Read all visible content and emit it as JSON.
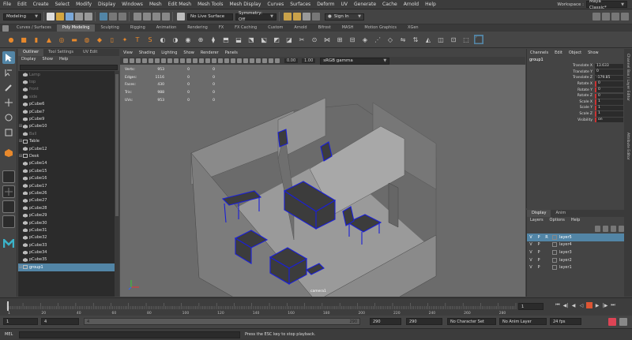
{
  "menubar": {
    "items": [
      "File",
      "Edit",
      "Create",
      "Select",
      "Modify",
      "Display",
      "Windows",
      "Mesh",
      "Edit Mesh",
      "Mesh Tools",
      "Mesh Display",
      "Curves",
      "Surfaces",
      "Deform",
      "UV",
      "Generate",
      "Cache",
      "Arnold",
      "Help"
    ],
    "workspace_label": "Workspace :",
    "workspace_value": "Maya Classic*"
  },
  "statusline": {
    "mode": "Modeling",
    "live_surface": "No Live Surface",
    "symmetry": "Symmetry: Off",
    "sign_in": "Sign In"
  },
  "shelf": {
    "tabs": [
      "Curves / Surfaces",
      "Poly Modeling",
      "Sculpting",
      "Rigging",
      "Animation",
      "Rendering",
      "FX",
      "FX Caching",
      "Custom",
      "Arnold",
      "Bifrost",
      "MASH",
      "Motion Graphics",
      "XGen"
    ],
    "active_tab": "Poly Modeling"
  },
  "outliner": {
    "tabs": [
      "Outliner",
      "Tool Settings",
      "UV Edit"
    ],
    "menu": [
      "Display",
      "Show",
      "Help"
    ],
    "items": [
      {
        "label": "Lamp",
        "dim": true,
        "group": false,
        "expand": false
      },
      {
        "label": "top",
        "dim": true,
        "group": false,
        "expand": false
      },
      {
        "label": "front",
        "dim": true,
        "group": false,
        "expand": false
      },
      {
        "label": "side",
        "dim": true,
        "group": false,
        "expand": false
      },
      {
        "label": "pCube6",
        "dim": false,
        "group": false,
        "expand": false
      },
      {
        "label": "pCube7",
        "dim": false,
        "group": false,
        "expand": false
      },
      {
        "label": "pCube9",
        "dim": false,
        "group": false,
        "expand": false
      },
      {
        "label": "pCube10",
        "dim": false,
        "group": false,
        "expand": true
      },
      {
        "label": "Ball",
        "dim": true,
        "group": false,
        "expand": false
      },
      {
        "label": "Table",
        "dim": false,
        "group": true,
        "expand": true
      },
      {
        "label": "pCube12",
        "dim": false,
        "group": false,
        "expand": false
      },
      {
        "label": "Desk",
        "dim": false,
        "group": true,
        "expand": true
      },
      {
        "label": "pCube14",
        "dim": false,
        "group": false,
        "expand": false
      },
      {
        "label": "pCube15",
        "dim": false,
        "group": false,
        "expand": false
      },
      {
        "label": "pCube16",
        "dim": false,
        "group": false,
        "expand": false
      },
      {
        "label": "pCube17",
        "dim": false,
        "group": false,
        "expand": false
      },
      {
        "label": "pCube26",
        "dim": false,
        "group": false,
        "expand": false
      },
      {
        "label": "pCube27",
        "dim": false,
        "group": false,
        "expand": false
      },
      {
        "label": "pCube28",
        "dim": false,
        "group": false,
        "expand": false
      },
      {
        "label": "pCube29",
        "dim": false,
        "group": false,
        "expand": false
      },
      {
        "label": "pCube30",
        "dim": false,
        "group": false,
        "expand": false
      },
      {
        "label": "pCube31",
        "dim": false,
        "group": false,
        "expand": false
      },
      {
        "label": "pCube32",
        "dim": false,
        "group": false,
        "expand": false
      },
      {
        "label": "pCube33",
        "dim": false,
        "group": false,
        "expand": false
      },
      {
        "label": "pCube34",
        "dim": false,
        "group": false,
        "expand": false
      },
      {
        "label": "pCube35",
        "dim": false,
        "group": false,
        "expand": false
      },
      {
        "label": "group1",
        "dim": false,
        "group": true,
        "expand": true,
        "selected": true
      }
    ]
  },
  "viewport": {
    "menu": [
      "View",
      "Shading",
      "Lighting",
      "Show",
      "Renderer",
      "Panels"
    ],
    "colorspace": "sRGB gamma",
    "exposure": "0.00",
    "gamma": "1.00",
    "camera_label": "camera1",
    "hud": [
      {
        "label": "Verts:",
        "v1": "953",
        "v2": "0",
        "v3": "0"
      },
      {
        "label": "Edges:",
        "v1": "1116",
        "v2": "0",
        "v3": "0"
      },
      {
        "label": "Faces:",
        "v1": "430",
        "v2": "0",
        "v3": "0"
      },
      {
        "label": "Tris:",
        "v1": "988",
        "v2": "0",
        "v3": "0"
      },
      {
        "label": "UVs:",
        "v1": "953",
        "v2": "0",
        "v3": "0"
      }
    ]
  },
  "channelbox": {
    "menu": [
      "Channels",
      "Edit",
      "Object",
      "Show"
    ],
    "object": "group1",
    "attributes": [
      {
        "name": "Translate X",
        "value": "13.633",
        "keyed": false
      },
      {
        "name": "Translate Y",
        "value": "0",
        "keyed": false
      },
      {
        "name": "Translate Z",
        "value": "-179.85",
        "keyed": false
      },
      {
        "name": "Rotate X",
        "value": "0",
        "keyed": true
      },
      {
        "name": "Rotate Y",
        "value": "0",
        "keyed": true
      },
      {
        "name": "Rotate Z",
        "value": "0",
        "keyed": true
      },
      {
        "name": "Scale X",
        "value": "1",
        "keyed": true
      },
      {
        "name": "Scale Y",
        "value": "1",
        "keyed": true
      },
      {
        "name": "Scale Z",
        "value": "1",
        "keyed": true
      },
      {
        "name": "Visibility",
        "value": "on",
        "keyed": true
      }
    ]
  },
  "layers": {
    "tabs": [
      "Display",
      "Anim"
    ],
    "menu": [
      "Layers",
      "Options",
      "Help"
    ],
    "rows": [
      {
        "v": "V",
        "p": "P",
        "r": "R",
        "name": "layer5",
        "selected": true
      },
      {
        "v": "V",
        "p": "P",
        "r": "",
        "name": "layer4",
        "selected": false
      },
      {
        "v": "V",
        "p": "P",
        "r": "",
        "name": "layer3",
        "selected": false
      },
      {
        "v": "V",
        "p": "P",
        "r": "",
        "name": "layer2",
        "selected": false
      },
      {
        "v": "V",
        "p": "P",
        "r": "",
        "name": "layer1",
        "selected": false
      }
    ]
  },
  "sidetabs": [
    "Channel Box / Layer Editor",
    "Attribute Editor"
  ],
  "timeslider": {
    "current_frame": "1",
    "ticks": [
      "1",
      "20",
      "40",
      "60",
      "80",
      "100",
      "120",
      "140",
      "160",
      "180",
      "200",
      "220",
      "240",
      "260",
      "280"
    ]
  },
  "range": {
    "start": "1",
    "playback_start": "4",
    "bar_left": "4",
    "bar_right": "290",
    "playback_end": "290",
    "end": "290",
    "character_set": "No Character Set",
    "anim_layer": "No Anim Layer",
    "fps": "24 fps"
  },
  "cmdline": {
    "label": "MEL",
    "help": "Press the ESC key to stop playback."
  },
  "colors": {
    "accent": "#5285a6",
    "shelf_orange": "#e8892c",
    "selection_blue": "#1a1fd8"
  }
}
